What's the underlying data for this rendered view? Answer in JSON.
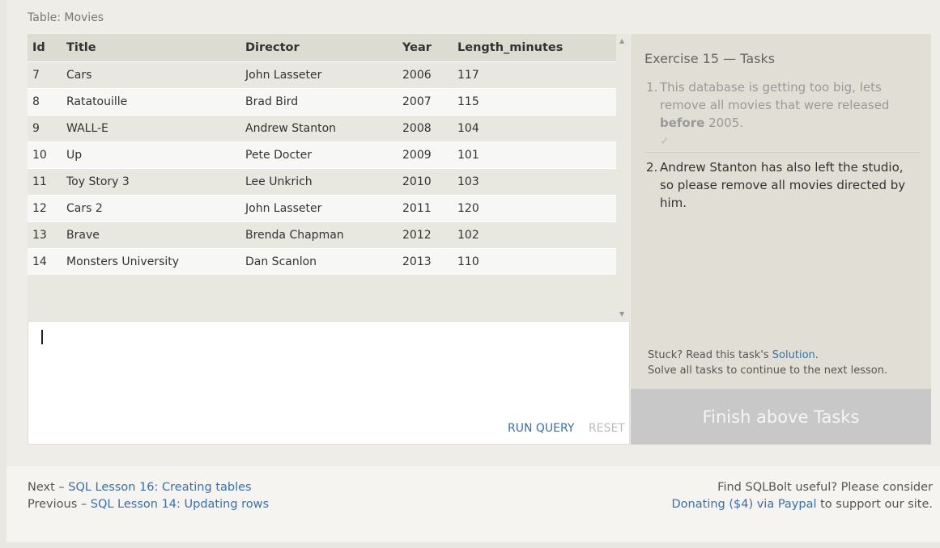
{
  "table": {
    "caption": "Table: Movies",
    "columns": [
      "Id",
      "Title",
      "Director",
      "Year",
      "Length_minutes"
    ],
    "rows": [
      [
        "7",
        "Cars",
        "John Lasseter",
        "2006",
        "117"
      ],
      [
        "8",
        "Ratatouille",
        "Brad Bird",
        "2007",
        "115"
      ],
      [
        "9",
        "WALL-E",
        "Andrew Stanton",
        "2008",
        "104"
      ],
      [
        "10",
        "Up",
        "Pete Docter",
        "2009",
        "101"
      ],
      [
        "11",
        "Toy Story 3",
        "Lee Unkrich",
        "2010",
        "103"
      ],
      [
        "12",
        "Cars 2",
        "John Lasseter",
        "2011",
        "120"
      ],
      [
        "13",
        "Brave",
        "Brenda Chapman",
        "2012",
        "102"
      ],
      [
        "14",
        "Monsters University",
        "Dan Scanlon",
        "2013",
        "110"
      ]
    ]
  },
  "editor": {
    "value": "",
    "run_label": "RUN QUERY",
    "reset_label": "RESET"
  },
  "tasks": {
    "title": "Exercise 15 — Tasks",
    "task1": {
      "num": "1.",
      "text_before": "This database is getting too big, lets remove all movies that were released ",
      "emphasis": "before",
      "text_after": " 2005.",
      "check": "✓"
    },
    "task2": {
      "num": "2.",
      "text": "Andrew Stanton has also left the studio, so please remove all movies directed by him."
    },
    "stuck_prefix": "Stuck? Read this task's ",
    "solution_link": "Solution",
    "stuck_suffix": ".",
    "continue_text": "Solve all tasks to continue to the next lesson.",
    "finish_label": "Finish above Tasks"
  },
  "footer": {
    "next_prefix": "Next – ",
    "next_link": "SQL Lesson 16: Creating tables",
    "prev_prefix": "Previous – ",
    "prev_link": "SQL Lesson 14: Updating rows",
    "donate_line1": "Find SQLBolt useful? Please consider",
    "donate_link": "Donating ($4) via Paypal",
    "donate_suffix": " to support our site."
  },
  "colors": {
    "link": "#3a6fa8",
    "finish_button": "#c8c8c8",
    "tasks_panel": "#e1dfd5"
  }
}
